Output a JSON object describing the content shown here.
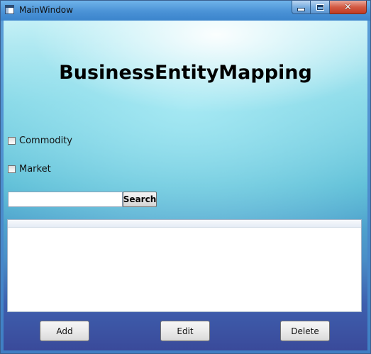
{
  "window": {
    "title": "MainWindow",
    "icon": "window-app-icon",
    "caption_buttons": {
      "minimize_icon": "minimize-icon",
      "maximize_icon": "maximize-icon",
      "close_glyph": "✕"
    }
  },
  "main": {
    "heading": "BusinessEntityMapping",
    "checkboxes": [
      {
        "label": "Commodity",
        "checked": false
      },
      {
        "label": "Market",
        "checked": false
      }
    ],
    "search": {
      "value": "",
      "placeholder": "",
      "button_label": "Search"
    },
    "list": {
      "items": []
    },
    "actions": {
      "add_label": "Add",
      "edit_label": "Edit",
      "delete_label": "Delete"
    }
  },
  "colors": {
    "titlebar": "#4a92d6",
    "close_button": "#c03a22",
    "background_top": "#c9f1f6",
    "background_bottom": "#3a4a9a"
  }
}
